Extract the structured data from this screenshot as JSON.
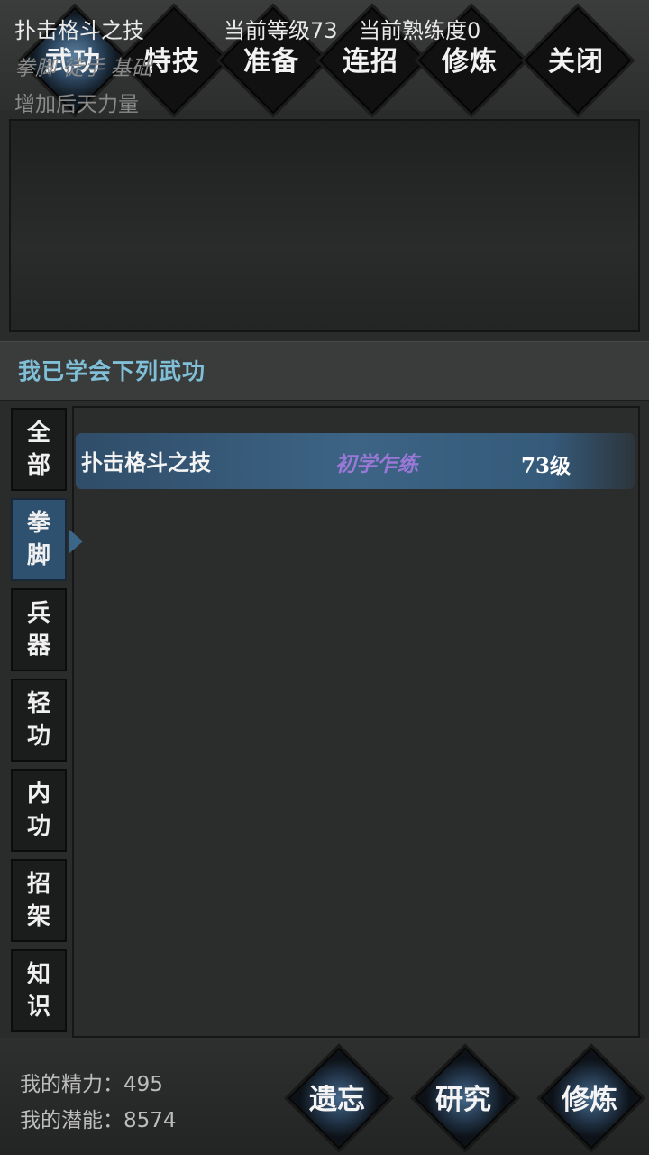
{
  "tabs": [
    {
      "label": "武功",
      "active": true
    },
    {
      "label": "特技",
      "active": false
    },
    {
      "label": "准备",
      "active": false
    },
    {
      "label": "连招",
      "active": false
    },
    {
      "label": "修炼",
      "active": false
    },
    {
      "label": "关闭",
      "active": false
    }
  ],
  "detail": {
    "name": "扑击格斗之技",
    "level": "当前等级73",
    "proficiency": "当前熟练度0",
    "tags": "拳脚 徒手 基础",
    "description": "增加后天力量"
  },
  "learned_title": "我已学会下列武功",
  "categories": [
    {
      "line1": "全",
      "line2": "部",
      "active": false
    },
    {
      "line1": "拳",
      "line2": "脚",
      "active": true
    },
    {
      "line1": "兵",
      "line2": "器",
      "active": false
    },
    {
      "line1": "轻",
      "line2": "功",
      "active": false
    },
    {
      "line1": "内",
      "line2": "功",
      "active": false
    },
    {
      "line1": "招",
      "line2": "架",
      "active": false
    },
    {
      "line1": "知",
      "line2": "识",
      "active": false
    }
  ],
  "skills": [
    {
      "name": "扑击格斗之技",
      "stage": "初学乍练",
      "level": "73级"
    }
  ],
  "stats": {
    "energy": "我的精力：495",
    "potential": "我的潜能：8574"
  },
  "actions": {
    "forget": "遗忘",
    "research": "研究",
    "train": "修炼"
  },
  "colors": {
    "accent_blue": "#3d6485",
    "title_cyan": "#7fc0d8",
    "stage_purple": "#9a78d8"
  }
}
